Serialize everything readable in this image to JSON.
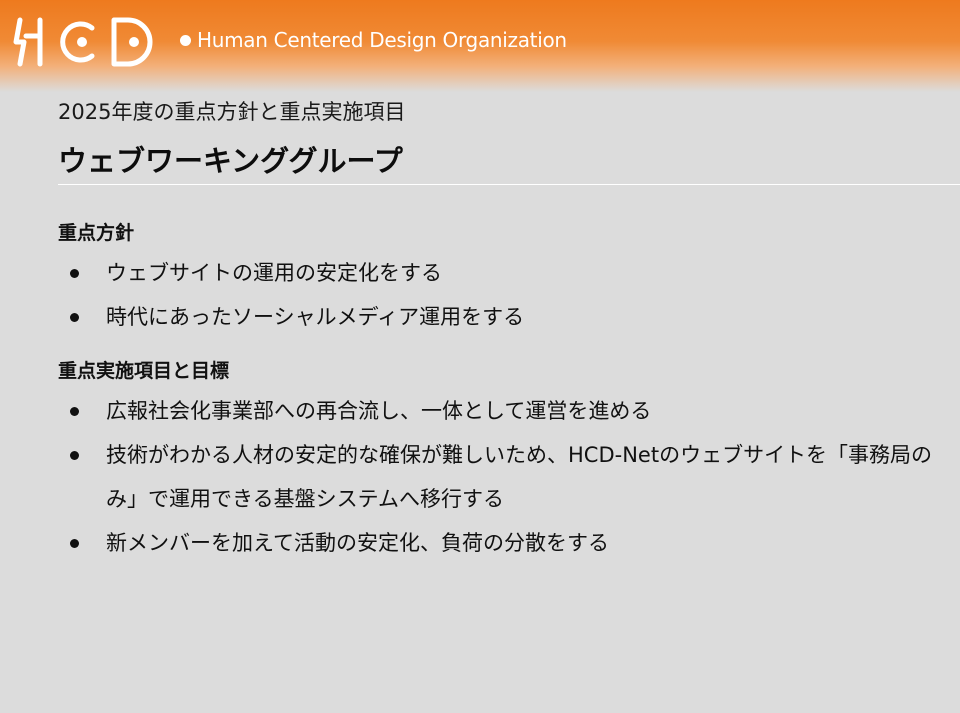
{
  "header": {
    "logo_text": "HCD",
    "tagline": "Human Centered Design Organization",
    "colors": {
      "band": "#ee7a1e",
      "logo": "#ffffff",
      "background": "#dcdcdc"
    }
  },
  "subtitle": "2025年度の重点方針と重点実施項目",
  "title": "ウェブワーキンググループ",
  "sections": [
    {
      "heading": "重点方針",
      "items": [
        "ウェブサイトの運用の安定化をする",
        "時代にあったソーシャルメディア運用をする"
      ]
    },
    {
      "heading": "重点実施項目と目標",
      "items": [
        "広報社会化事業部への再合流し、一体として運営を進める",
        "技術がわかる人材の安定的な確保が難しいため、HCD-Netのウェブサイトを「事務局のみ」で運用できる基盤システムへ移行する",
        "新メンバーを加えて活動の安定化、負荷の分散をする"
      ]
    }
  ]
}
